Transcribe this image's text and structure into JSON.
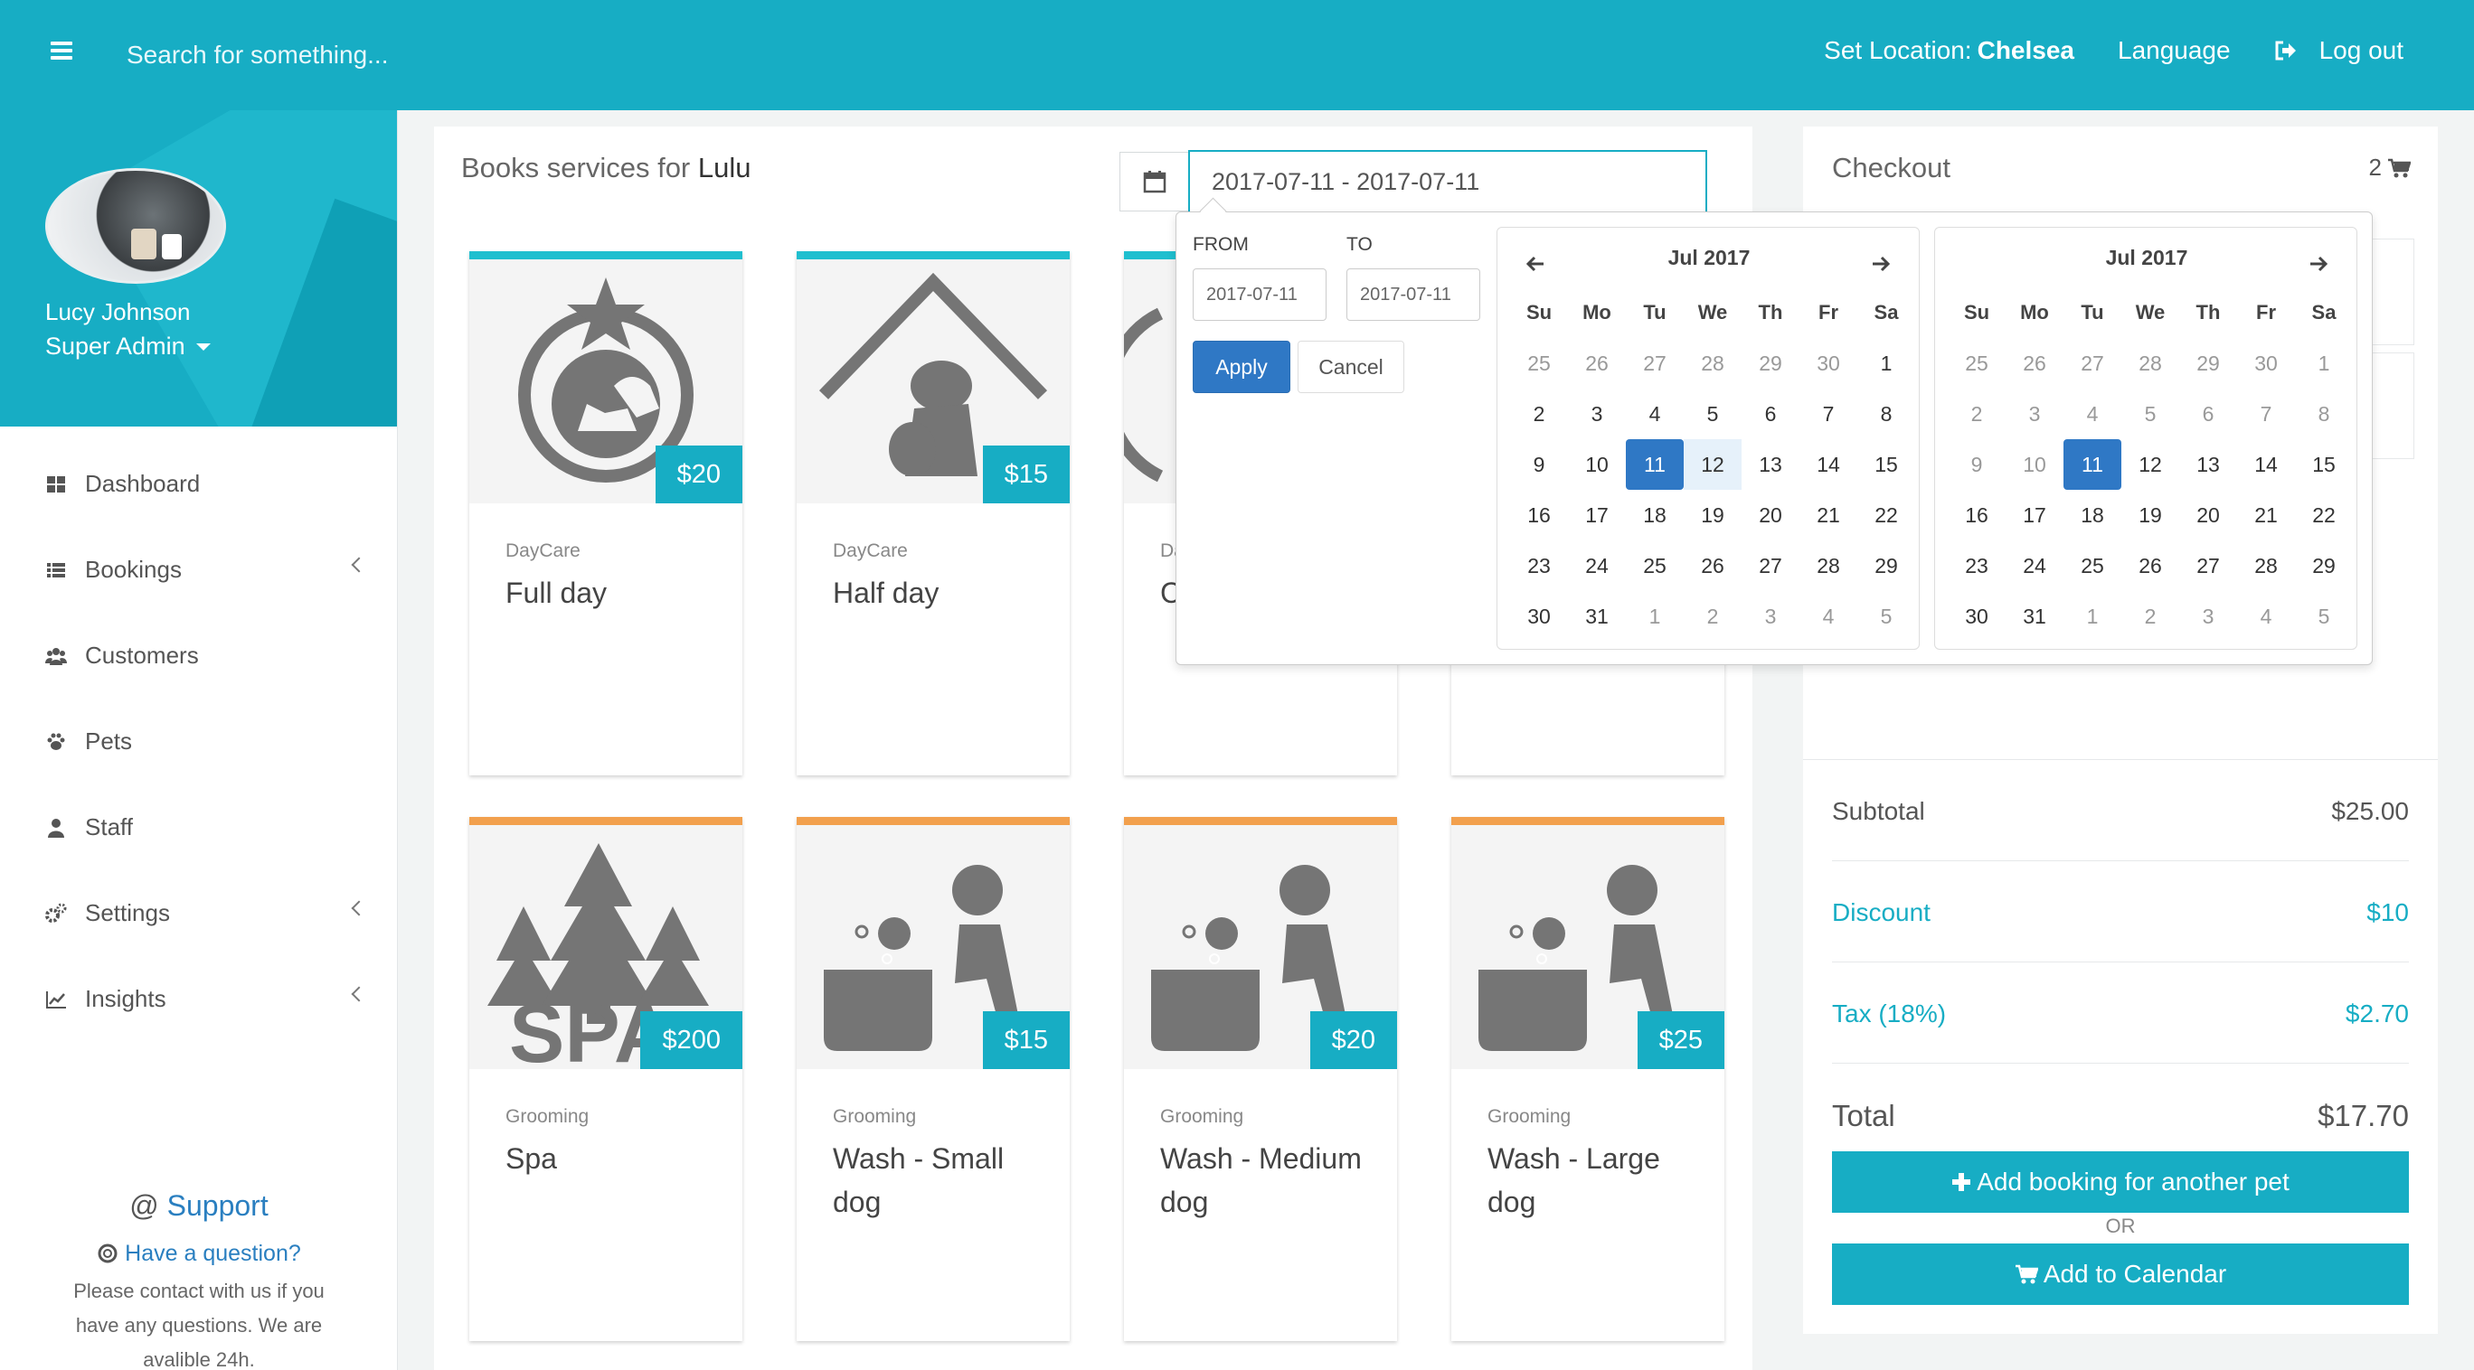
{
  "topbar": {
    "search_placeholder": "Search for something...",
    "location_label": "Set Location:",
    "location_value": "Chelsea",
    "language": "Language",
    "logout": "Log out"
  },
  "sidebar": {
    "user_name": "Lucy Johnson",
    "user_role": "Super Admin",
    "items": [
      {
        "label": "Dashboard"
      },
      {
        "label": "Bookings"
      },
      {
        "label": "Customers"
      },
      {
        "label": "Pets"
      },
      {
        "label": "Staff"
      },
      {
        "label": "Settings"
      },
      {
        "label": "Insights"
      }
    ],
    "support": {
      "title": "Support",
      "question": "Have a question?",
      "text": "Please contact with us if you have any questions. We are avalible 24h."
    }
  },
  "services": {
    "title_prefix": "Books services for",
    "pet_name": "Lulu",
    "date_range": "2017-07-11 - 2017-07-11",
    "cards": [
      {
        "category": "DayCare",
        "name": "Full day",
        "price": "$20",
        "accent": "#1fbfcf"
      },
      {
        "category": "DayCare",
        "name": "Half day",
        "price": "$15",
        "accent": "#1fbfcf"
      },
      {
        "category": "Da",
        "name": "C",
        "price": "",
        "accent": "#1fbfcf"
      },
      {
        "category": "",
        "name": "",
        "price": "",
        "accent": "#1fbfcf"
      },
      {
        "category": "Grooming",
        "name": "Spa",
        "price": "$200",
        "accent": "#f2a04d"
      },
      {
        "category": "Grooming",
        "name": "Wash - Small dog",
        "price": "$15",
        "accent": "#f2a04d"
      },
      {
        "category": "Grooming",
        "name": "Wash - Medium dog",
        "price": "$20",
        "accent": "#f2a04d"
      },
      {
        "category": "Grooming",
        "name": "Wash - Large dog",
        "price": "$25",
        "accent": "#f2a04d"
      }
    ]
  },
  "checkout": {
    "title": "Checkout",
    "cart_count": "2",
    "subtotal_label": "Subtotal",
    "subtotal_value": "$25.00",
    "discount_label": "Discount",
    "discount_value": "$10",
    "tax_label": "Tax (18%)",
    "tax_value": "$2.70",
    "total_label": "Total",
    "total_value": "$17.70",
    "add_booking": "Add booking for another pet",
    "or": "OR",
    "add_calendar": "Add to Calendar"
  },
  "picker": {
    "from_label": "FROM",
    "to_label": "TO",
    "from_value": "2017-07-11",
    "to_value": "2017-07-11",
    "apply": "Apply",
    "cancel": "Cancel",
    "weekdays": [
      "Su",
      "Mo",
      "Tu",
      "We",
      "Th",
      "Fr",
      "Sa"
    ],
    "left_month": "Jul 2017",
    "right_month": "Jul 2017",
    "left_weeks": [
      [
        "25",
        "26",
        "27",
        "28",
        "29",
        "30",
        "1"
      ],
      [
        "2",
        "3",
        "4",
        "5",
        "6",
        "7",
        "8"
      ],
      [
        "9",
        "10",
        "11",
        "12",
        "13",
        "14",
        "15"
      ],
      [
        "16",
        "17",
        "18",
        "19",
        "20",
        "21",
        "22"
      ],
      [
        "23",
        "24",
        "25",
        "26",
        "27",
        "28",
        "29"
      ],
      [
        "30",
        "31",
        "1",
        "2",
        "3",
        "4",
        "5"
      ]
    ],
    "right_weeks": [
      [
        "25",
        "26",
        "27",
        "28",
        "29",
        "30",
        "1"
      ],
      [
        "2",
        "3",
        "4",
        "5",
        "6",
        "7",
        "8"
      ],
      [
        "9",
        "10",
        "11",
        "12",
        "13",
        "14",
        "15"
      ],
      [
        "16",
        "17",
        "18",
        "19",
        "20",
        "21",
        "22"
      ],
      [
        "23",
        "24",
        "25",
        "26",
        "27",
        "28",
        "29"
      ],
      [
        "30",
        "31",
        "1",
        "2",
        "3",
        "4",
        "5"
      ]
    ],
    "selected_day": "11"
  },
  "colors": {
    "brand": "#17adc4",
    "accent_daycare": "#1fbfcf",
    "accent_grooming": "#f2a04d",
    "picker_selected": "#2f78c5"
  },
  "icons": [
    "menu-icon",
    "logout-icon",
    "calendar-icon",
    "cart-icon",
    "dashboard-icon",
    "bookings-icon",
    "customers-icon",
    "paw-icon",
    "staff-icon",
    "settings-icon",
    "insights-icon",
    "lifebuoy-icon",
    "plus-icon"
  ]
}
